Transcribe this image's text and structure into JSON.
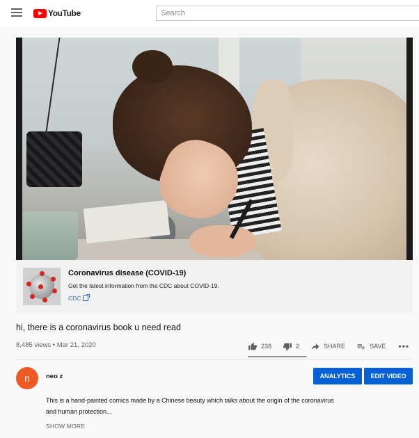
{
  "header": {
    "logo_text": "YouTube",
    "search_placeholder": "Search",
    "icons": [
      "menu-icon",
      "youtube-logo-icon"
    ]
  },
  "info_panel": {
    "title": "Coronavirus disease (COVID-19)",
    "description": "Get the latest information from the CDC about COVID-19.",
    "link_label": "CDC",
    "link_icon": "external-link-icon"
  },
  "video": {
    "title": "hi, there is a coronavirus book u need read",
    "meta": "8,485 views • Mar 21, 2020",
    "likes": "238",
    "dislikes": "2",
    "share_label": "SHARE",
    "save_label": "SAVE",
    "more_label": "•••",
    "like_ratio": 0.99
  },
  "channel": {
    "avatar_letter": "n",
    "name": "neo z",
    "analytics_label": "ANALYTICS",
    "edit_label": "EDIT VIDEO"
  },
  "description": {
    "text": "This is a hand-painted comics  made by a  Chinese beauty which talks about the origin of the coronavirus and human protection...",
    "show_more_label": "SHOW MORE"
  },
  "colors": {
    "accent": "#065fd4",
    "brand_red": "#ff0000",
    "avatar": "#ee5a24",
    "link": "#3366cc"
  }
}
